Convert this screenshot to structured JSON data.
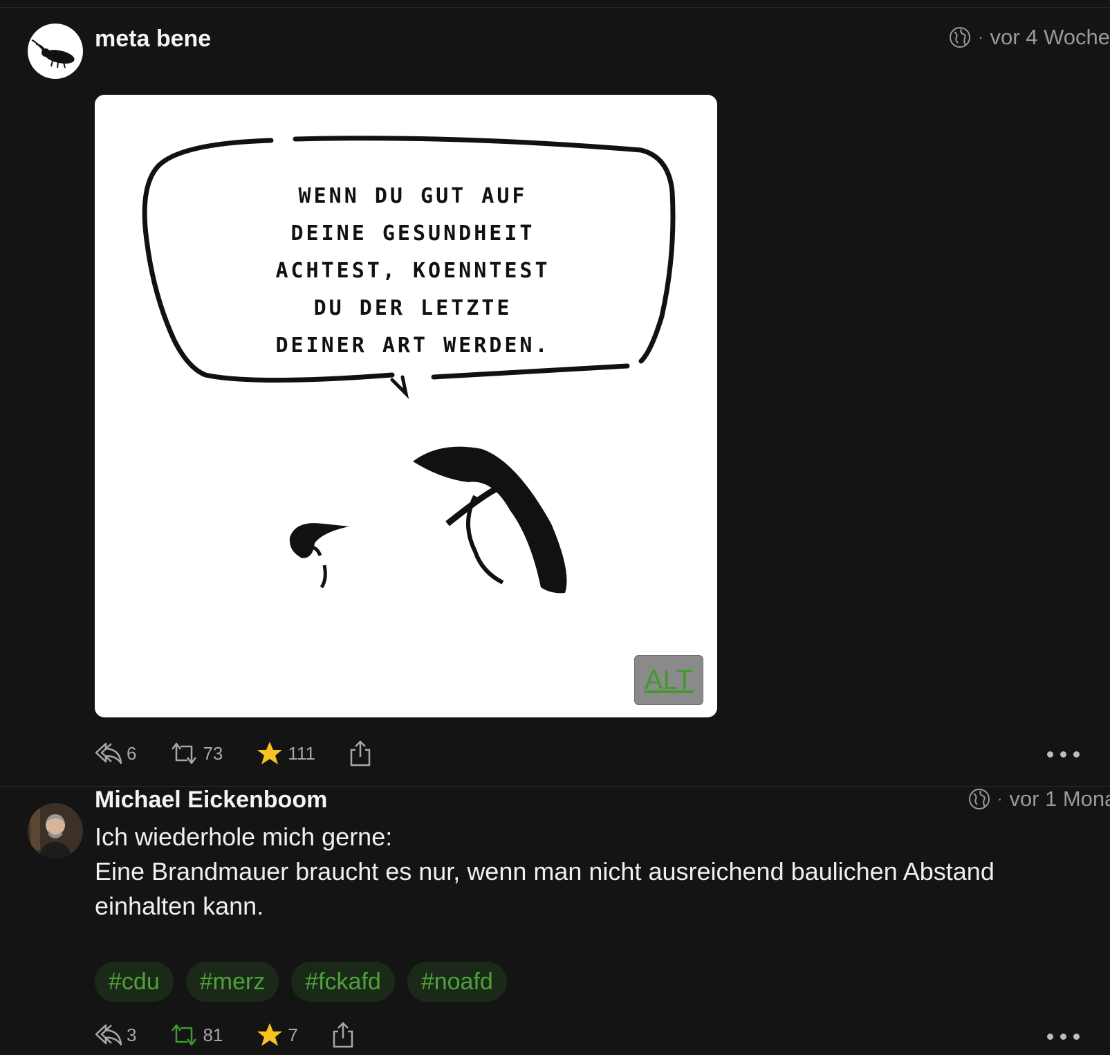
{
  "posts": [
    {
      "author": "meta bene",
      "time": "vor 4 Woche",
      "image": {
        "text_lines": [
          "Wenn du gut auf",
          "deine Gesundheit",
          "achtest, koenntest",
          "du der letzte",
          "deiner art werden."
        ],
        "alt_label": "ALT"
      },
      "actions": {
        "replies": "6",
        "boosts": "73",
        "favourites": "111"
      }
    },
    {
      "author": "Michael Eickenboom",
      "time": "vor 1 Mona",
      "content_line1": "Ich wiederhole mich gerne:",
      "content_line2": "Eine Brandmauer braucht es nur, wenn man nicht ausreichend baulichen Abstand einhalten kann.",
      "tags": [
        "#cdu",
        "#merz",
        "#fckafd",
        "#noafd"
      ],
      "actions": {
        "replies": "3",
        "boosts": "81",
        "favourites": "7"
      }
    }
  ],
  "colors": {
    "background": "#141414",
    "boost_active": "#3f9b2e",
    "star": "#f6c320",
    "tag_bg": "#1b2a18",
    "tag_text": "#4ea23a"
  }
}
